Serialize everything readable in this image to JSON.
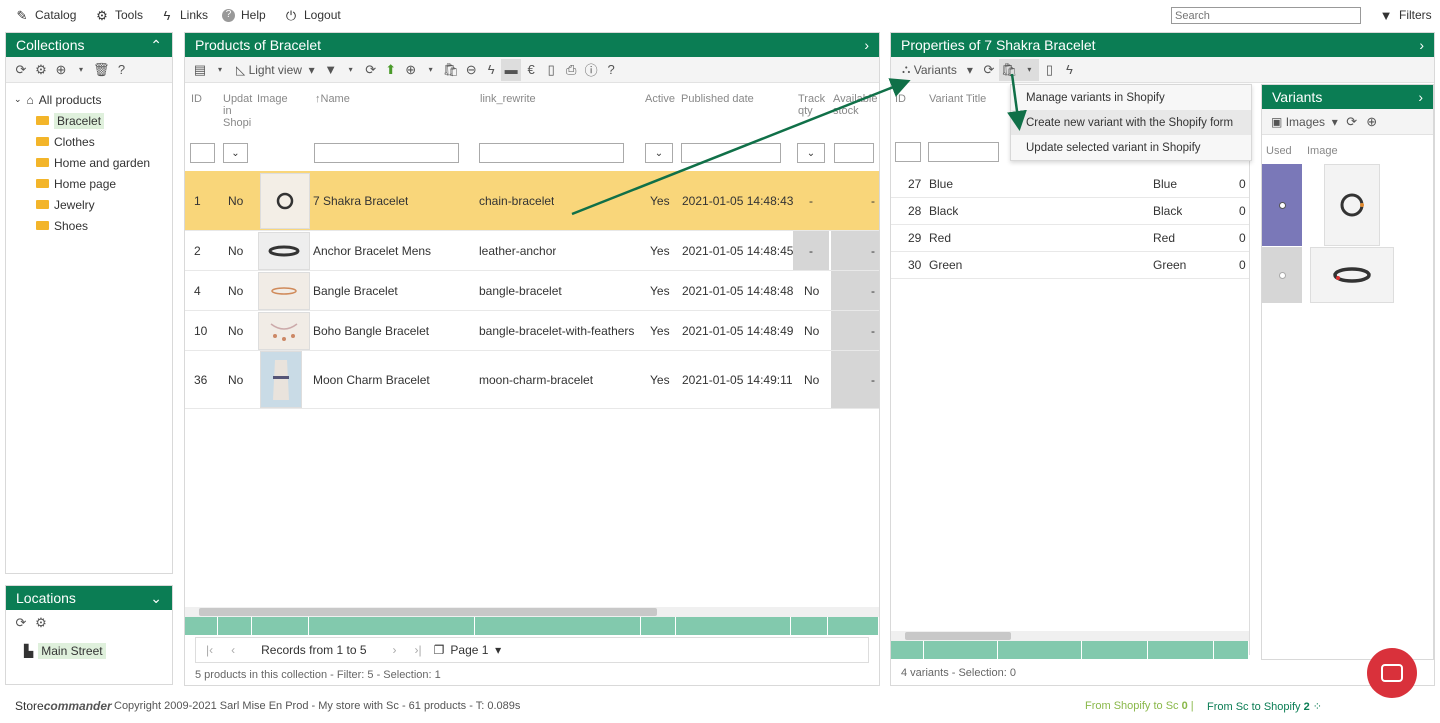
{
  "topbar": {
    "catalog": "Catalog",
    "tools": "Tools",
    "links": "Links",
    "help": "Help",
    "logout": "Logout",
    "search_placeholder": "Search",
    "filters": "Filters"
  },
  "collections": {
    "title": "Collections",
    "root": "All products",
    "items": [
      "Bracelet",
      "Clothes",
      "Home and garden",
      "Home page",
      "Jewelry",
      "Shoes"
    ]
  },
  "locations": {
    "title": "Locations",
    "items": [
      "Main Street"
    ]
  },
  "products": {
    "title": "Products of Bracelet",
    "light_view": "Light view",
    "columns": {
      "id": "ID",
      "updated": "Updat in Shopi",
      "image": "Image",
      "name": "Name",
      "link_rewrite": "link_rewrite",
      "active": "Active",
      "published": "Published date",
      "track": "Track qty",
      "available": "Available stock"
    },
    "rows": [
      {
        "id": "1",
        "updated": "No",
        "name": "7 Shakra Bracelet",
        "link": "chain-bracelet",
        "active": "Yes",
        "published": "2021-01-05 14:48:43",
        "track": "-",
        "available": "-"
      },
      {
        "id": "2",
        "updated": "No",
        "name": "Anchor Bracelet Mens",
        "link": "leather-anchor",
        "active": "Yes",
        "published": "2021-01-05 14:48:45",
        "track": "-",
        "available": "-"
      },
      {
        "id": "4",
        "updated": "No",
        "name": "Bangle Bracelet",
        "link": "bangle-bracelet",
        "active": "Yes",
        "published": "2021-01-05 14:48:48",
        "track": "No",
        "available": "-"
      },
      {
        "id": "10",
        "updated": "No",
        "name": "Boho Bangle Bracelet",
        "link": "bangle-bracelet-with-feathers",
        "active": "Yes",
        "published": "2021-01-05 14:48:49",
        "track": "No",
        "available": "-"
      },
      {
        "id": "36",
        "updated": "No",
        "name": "Moon Charm Bracelet",
        "link": "moon-charm-bracelet",
        "active": "Yes",
        "published": "2021-01-05 14:49:11",
        "track": "No",
        "available": "-"
      }
    ],
    "records": "Records from 1 to 5",
    "page": "Page 1",
    "status": "5 products in this collection - Filter: 5 - Selection: 1"
  },
  "properties": {
    "title": "Properties of 7 Shakra Bracelet",
    "variants_btn": "Variants",
    "col_id": "ID",
    "col_title": "Variant Title",
    "menu": [
      "Manage variants in Shopify",
      "Create new variant with the Shopify form",
      "Update selected variant in Shopify"
    ],
    "rows": [
      {
        "id": "27",
        "title": "Blue",
        "opt": "Blue",
        "v": "0"
      },
      {
        "id": "28",
        "title": "Black",
        "opt": "Black",
        "v": "0"
      },
      {
        "id": "29",
        "title": "Red",
        "opt": "Red",
        "v": "0"
      },
      {
        "id": "30",
        "title": "Green",
        "opt": "Green",
        "v": "0"
      }
    ],
    "status": "4 variants - Selection: 0"
  },
  "variants_panel": {
    "title": "Variants",
    "images_btn": "Images",
    "col_used": "Used",
    "col_image": "Image"
  },
  "footer": {
    "brand_a": "Store",
    "brand_b": "commander",
    "copyright": "Copyright 2009-2021 Sarl Mise En Prod - My store with Sc - 61 products - T: 0.089s",
    "from_shopify_label": "From Shopify to Sc",
    "from_shopify_count": "0",
    "from_sc_label": "From Sc to Shopify",
    "from_sc_count": "2"
  },
  "colors": {
    "header_green": "#0b7d54",
    "selected_row": "#f9d67a",
    "variant_used": "#7a78b8",
    "chat_button": "#d9313b"
  }
}
